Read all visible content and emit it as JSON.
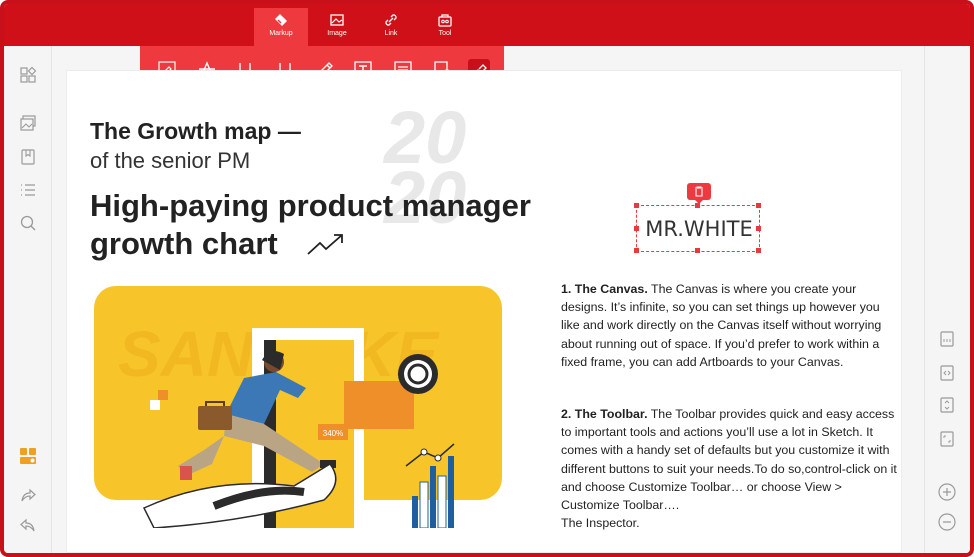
{
  "toolbar": {
    "tabs": [
      {
        "label": "Markup"
      },
      {
        "label": "Image"
      },
      {
        "label": "Link"
      },
      {
        "label": "Tool"
      }
    ]
  },
  "markup_tools": [
    "highlight-icon",
    "strikethrough-icon",
    "underline-icon",
    "squiggly-underline-icon",
    "pencil-icon",
    "text-box-icon",
    "note-icon",
    "shape-icon",
    "stamp-icon"
  ],
  "document": {
    "heading_line1": "The Growth map —",
    "heading_line2": "of the senior PM",
    "year_top": "20",
    "year_bottom": "20",
    "title_line1": "High-paying product manager",
    "title_line2": "growth chart",
    "signature": "MR.WHITE",
    "badge": "340%",
    "watermark": "SANJIEKE",
    "section1_title": "1. The Canvas.",
    "section1_body": " The Canvas is where you create your designs. It’s infinite, so you can set things up however you like and work directly on the Canvas itself without worrying about running out of space. If you’d prefer to work within a fixed frame, you can add Artboards to your Canvas.",
    "section2_title": "2. The Toolbar.",
    "section2_body": " The Toolbar provides quick and easy access to important tools and actions you’ll use a lot in Sketch. It comes with a handy set of defaults but you customize it with different buttons to suit your needs.To do so,control-click on it and choose Customize Toolbar… or choose View > Customize Toolbar….",
    "section2_tail": "The Inspector."
  },
  "colors": {
    "brand": "#d01018",
    "accent": "#ee3a3f",
    "yellow": "#f7c52a"
  }
}
